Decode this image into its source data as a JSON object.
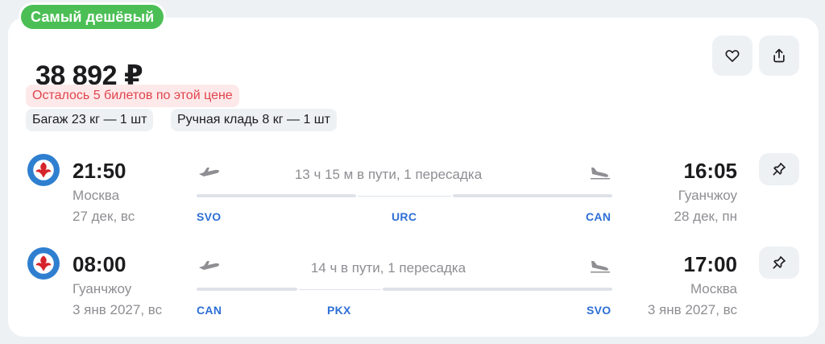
{
  "badge": "Самый дешёвый",
  "price": "38 892 ₽",
  "actions": {
    "favorite_icon": "heart-icon",
    "share_icon": "share-icon"
  },
  "tickets_left": "Осталось 5 билетов по этой цене",
  "baggage": "Багаж 23 кг — 1 шт",
  "hand_luggage": "Ручная кладь 8 кг — 1 шт",
  "colors": {
    "badge": "#4bbf55",
    "airport_code": "#2d6fd6",
    "warning": "#e0444c",
    "airline": "#2f7fd0"
  },
  "flights": [
    {
      "depart_time": "21:50",
      "depart_city": "Москва",
      "depart_date": "27 дек, вс",
      "duration": "13 ч 15 м в пути, 1 пересадка",
      "arrive_time": "16:05",
      "arrive_city": "Гуанчжоу",
      "arrive_date": "28 дек, пн",
      "from_code": "SVO",
      "stop_code": "URC",
      "to_code": "CAN"
    },
    {
      "depart_time": "08:00",
      "depart_city": "Гуанчжоу",
      "depart_date": "3 янв 2027, вс",
      "duration": "14 ч в пути, 1 пересадка",
      "arrive_time": "17:00",
      "arrive_city": "Москва",
      "arrive_date": "3 янв 2027, вс",
      "from_code": "CAN",
      "stop_code": "PKX",
      "to_code": "SVO"
    }
  ]
}
